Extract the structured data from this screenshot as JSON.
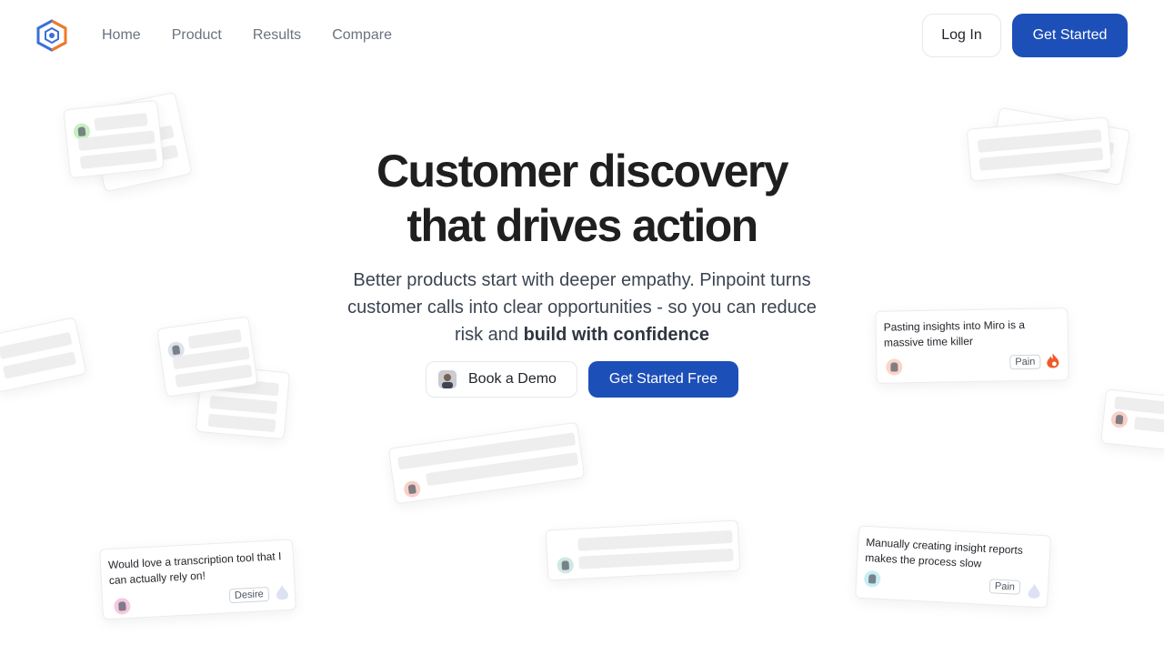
{
  "nav": {
    "links": [
      "Home",
      "Product",
      "Results",
      "Compare"
    ],
    "login_label": "Log In",
    "get_started_label": "Get Started"
  },
  "hero": {
    "title_line1": "Customer discovery",
    "title_line2": "that drives action",
    "subtitle": "Better products start with deeper empathy. Pinpoint turns customer calls into clear opportunities - so you can reduce risk and",
    "subtitle_bold": "build with confidence",
    "demo_label": "Book a Demo",
    "free_label": "Get Started Free"
  },
  "insights": [
    {
      "text": "Pasting insights into Miro is a massive time killer",
      "tag": "Pain"
    },
    {
      "text": "Would love a transcription tool that I can actually rely on!",
      "tag": "Desire"
    },
    {
      "text": "Manually creating insight reports makes the process slow",
      "tag": "Pain"
    }
  ],
  "colors": {
    "primary": "#1d4fb8",
    "logo_blue": "#3b6fd8",
    "logo_orange": "#f07a2a",
    "flame": "#f05a28"
  }
}
